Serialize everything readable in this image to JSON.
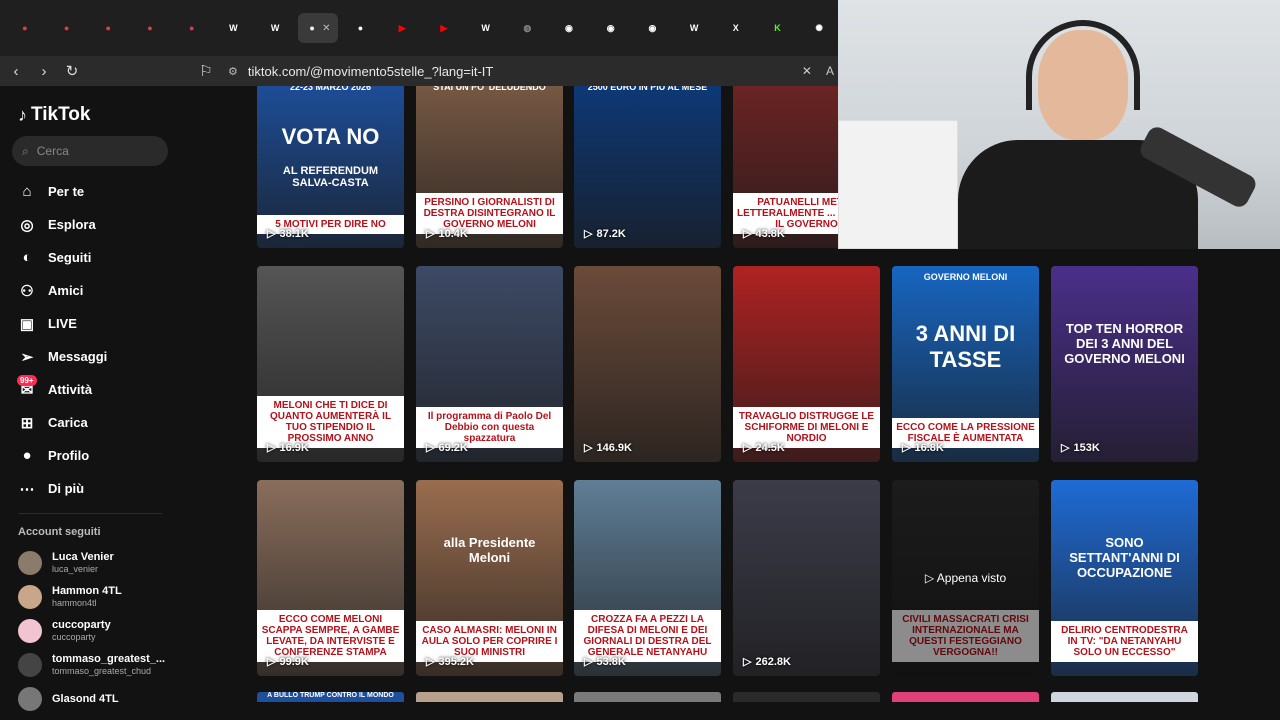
{
  "browser": {
    "url": "tiktok.com/@movimento5stelle_?lang=it-IT",
    "tabs": [
      {
        "icon": "tiktok-icon",
        "color": "#e63946"
      },
      {
        "icon": "tiktok-icon",
        "color": "#e63946"
      },
      {
        "icon": "tiktok-icon",
        "color": "#e63946"
      },
      {
        "icon": "tiktok-icon",
        "color": "#e63946"
      },
      {
        "icon": "tiktok-icon",
        "color": "#e63946"
      },
      {
        "icon": "wikipedia-icon",
        "color": "#ffffff"
      },
      {
        "icon": "wikipedia-icon",
        "color": "#ffffff"
      },
      {
        "icon": "tiktok-icon",
        "color": "#ffffff",
        "active": true
      },
      {
        "icon": "tiktok-icon",
        "color": "#ffffff"
      },
      {
        "icon": "youtube-icon",
        "color": "#ff0000"
      },
      {
        "icon": "youtube-icon",
        "color": "#ff0000"
      },
      {
        "icon": "wikipedia-icon",
        "color": "#ffffff"
      },
      {
        "icon": "globe-icon",
        "color": "#888888"
      },
      {
        "icon": "avatar-icon",
        "color": "#ffffff"
      },
      {
        "icon": "avatar-icon",
        "color": "#ffffff"
      },
      {
        "icon": "avatar-icon",
        "color": "#ffffff"
      },
      {
        "icon": "wikipedia-icon",
        "color": "#ffffff"
      },
      {
        "icon": "x-icon",
        "color": "#ffffff"
      },
      {
        "icon": "kick-icon",
        "color": "#53fc18"
      },
      {
        "icon": "openai-icon",
        "color": "#ffffff"
      }
    ]
  },
  "sidebar": {
    "logo": "TikTok",
    "search_placeholder": "Cerca",
    "nav": [
      {
        "label": "Per te",
        "icon": "home-icon"
      },
      {
        "label": "Esplora",
        "icon": "compass-icon"
      },
      {
        "label": "Seguiti",
        "icon": "following-icon"
      },
      {
        "label": "Amici",
        "icon": "friends-icon"
      },
      {
        "label": "LIVE",
        "icon": "live-icon"
      },
      {
        "label": "Messaggi",
        "icon": "send-icon"
      },
      {
        "label": "Attività",
        "icon": "inbox-icon",
        "badge": "99+"
      },
      {
        "label": "Carica",
        "icon": "upload-icon"
      },
      {
        "label": "Profilo",
        "icon": "profile-icon"
      },
      {
        "label": "Di più",
        "icon": "more-icon"
      }
    ],
    "followed_title": "Account seguiti",
    "accounts": [
      {
        "name": "Luca Venier",
        "handle": "luca_venier"
      },
      {
        "name": "Hammon  4TL",
        "handle": "hammon4tl"
      },
      {
        "name": "cuccoparty",
        "handle": "cuccoparty"
      },
      {
        "name": "tommaso_greatest_...",
        "handle": "tommaso_greatest_chud"
      },
      {
        "name": "Glasond 4TL",
        "handle": ""
      }
    ]
  },
  "videos": [
    {
      "top": "22-23 MARZO 2026",
      "title": "VOTA NO",
      "sub": "AL REFERENDUM SALVA-CASTA",
      "caption": "5 MOTIVI PER DIRE NO",
      "views": "38.1K",
      "bg": "#1d4f9c"
    },
    {
      "top": "STAI UN PO' DELUDENDO",
      "title": "",
      "sub": "",
      "caption": "PERSINO I GIORNALISTI DI DESTRA DISINTEGRANO IL GOVERNO MELONI",
      "views": "10.4K",
      "bg": "#7a5b45"
    },
    {
      "top": "2500 EURO IN PIÙ AL MESE",
      "title": "",
      "sub": "",
      "caption": "",
      "views": "87.2K",
      "bg": "#0d3a7a"
    },
    {
      "top": "",
      "title": "",
      "sub": "",
      "caption": "PATUANELLI METTE LETTERALMENTE ... MANDO IL GOVERNO",
      "views": "43.8K",
      "bg": "#6e2424"
    },
    {
      "top": "",
      "title": "",
      "sub": "",
      "caption": "MELONI CHE TI DICE DI QUANTO AUMENTERÀ IL TUO STIPENDIO IL PROSSIMO ANNO",
      "views": "16.9K",
      "bg": "#555555"
    },
    {
      "top": "",
      "title": "",
      "sub": "",
      "caption": "Il programma di Paolo Del Debbio con questa spazzatura",
      "views": "69.2K",
      "bg": "#3d4a66"
    },
    {
      "top": "",
      "title": "",
      "sub": "",
      "caption": "",
      "views": "146.9K",
      "bg": "#6b4b3a"
    },
    {
      "top": "",
      "title": "",
      "sub": "",
      "caption": "TRAVAGLIO DISTRUGGE LE SCHIFORME DI MELONI E NORDIO",
      "views": "24.5K",
      "bg": "#b02222"
    },
    {
      "top": "GOVERNO MELONI",
      "title": "3 ANNI DI TASSE",
      "sub": "",
      "caption": "ECCO COME LA PRESSIONE FISCALE È AUMENTATA",
      "views": "16.8K",
      "bg": "#1766c2"
    },
    {
      "top": "",
      "title": "TOP TEN HORROR DEI 3 ANNI DEL GOVERNO MELONI",
      "sub": "",
      "caption": "",
      "views": "153K",
      "bg": "#4a2f8a"
    },
    {
      "top": "",
      "title": "",
      "sub": "",
      "caption": "ECCO COME MELONI SCAPPA SEMPRE, A GAMBE LEVATE, DA INTERVISTE E CONFERENZE STAMPA",
      "views": "99.9K",
      "bg": "#8a6e5c"
    },
    {
      "top": "",
      "title": "alla Presidente Meloni",
      "sub": "",
      "caption": "CASO ALMASRI: MELONI IN AULA SOLO PER COPRIRE I SUOI MINISTRI",
      "views": "395.2K",
      "bg": "#9a6d4f"
    },
    {
      "top": "",
      "title": "",
      "sub": "",
      "caption": "CROZZA FA A PEZZI LA DIFESA DI MELONI E DEI GIORNALI DI DESTRA DEL GENERALE NETANYAHU",
      "views": "53.8K",
      "bg": "#5f7e96"
    },
    {
      "top": "",
      "title": "",
      "sub": "",
      "caption": "",
      "views": "262.8K",
      "bg": "#3b3c49"
    },
    {
      "top": "",
      "title": "Appena visto",
      "sub": "",
      "caption": "CIVILI MASSACRATI CRISI INTERNAZIONALE MA QUESTI FESTEGGIANO VERGOGNA!!",
      "views": "",
      "bg": "#333333"
    },
    {
      "top": "",
      "title": "SONO SETTANT'ANNI DI OCCUPAZIONE",
      "sub": "",
      "caption": "DELIRIO CENTRODESTRA IN TV: \"DA NETANYAHU SOLO UN ECCESSO\"",
      "views": "",
      "bg": "#1f6bd6"
    }
  ],
  "bottom_row_first": "A BULLO TRUMP CONTRO IL MONDO"
}
